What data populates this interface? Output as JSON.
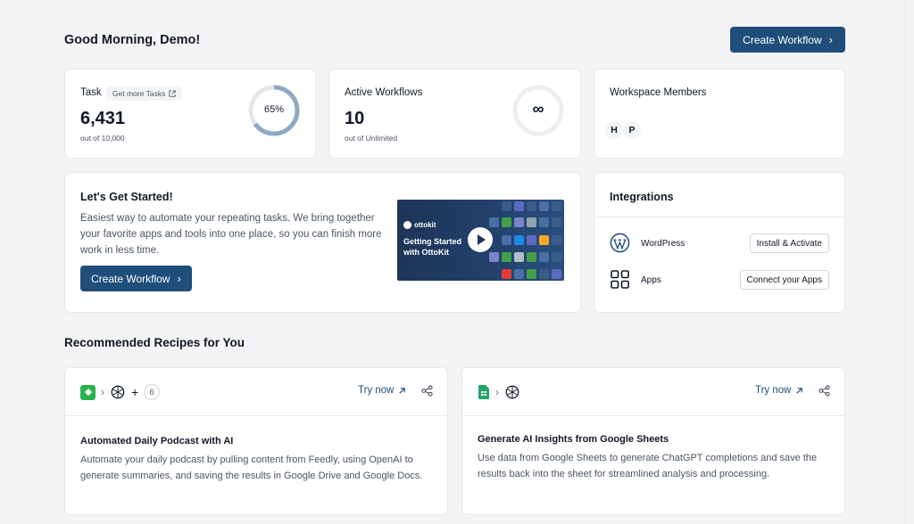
{
  "header": {
    "greeting": "Good Morning, Demo!",
    "create_workflow_label": "Create Workflow"
  },
  "stats": {
    "task": {
      "label": "Task",
      "chip_label": "Get more Tasks",
      "value": "6,431",
      "subtext": "out of 10,000",
      "percent_label": "65%",
      "percent": 0.65
    },
    "workflows": {
      "label": "Active Workflows",
      "value": "10",
      "subtext": "out of Unlimited",
      "ring_symbol": "∞"
    },
    "members": {
      "label": "Workspace Members",
      "avatars": [
        "H",
        "P"
      ]
    }
  },
  "getting_started": {
    "title": "Let's Get Started!",
    "description": "Easiest way to automate your repeating tasks. We bring together your favorite apps and tools into one place, so you can finish more work in less time.",
    "button_label": "Create Workflow",
    "video": {
      "brand": "ottokit",
      "title_line1": "Getting Started",
      "title_line2": "with OttoKit"
    }
  },
  "integrations": {
    "title": "Integrations",
    "items": [
      {
        "label": "WordPress",
        "action": "Install & Activate",
        "icon": "wordpress-icon"
      },
      {
        "label": "Apps",
        "action": "Connect your Apps",
        "icon": "apps-grid-icon"
      }
    ]
  },
  "recipes": {
    "section_title": "Recommended Recipes for You",
    "try_label": "Try now",
    "items": [
      {
        "icons": [
          "feedly-icon",
          "openai-icon"
        ],
        "extra_count": "6",
        "title": "Automated Daily Podcast with AI",
        "description": "Automate your daily podcast by pulling content from Feedly, using OpenAI to generate summaries, and saving the results in Google Drive and Google Docs."
      },
      {
        "icons": [
          "google-sheets-icon",
          "openai-icon"
        ],
        "title": "Generate AI Insights from Google Sheets",
        "description": "Use data from Google Sheets to generate ChatGPT completions and save the results back into the sheet for streamlined analysis and processing."
      }
    ]
  },
  "colors": {
    "primary": "#1e4e79",
    "ring": "#8fa9c3",
    "background": "#f4f4f6"
  }
}
